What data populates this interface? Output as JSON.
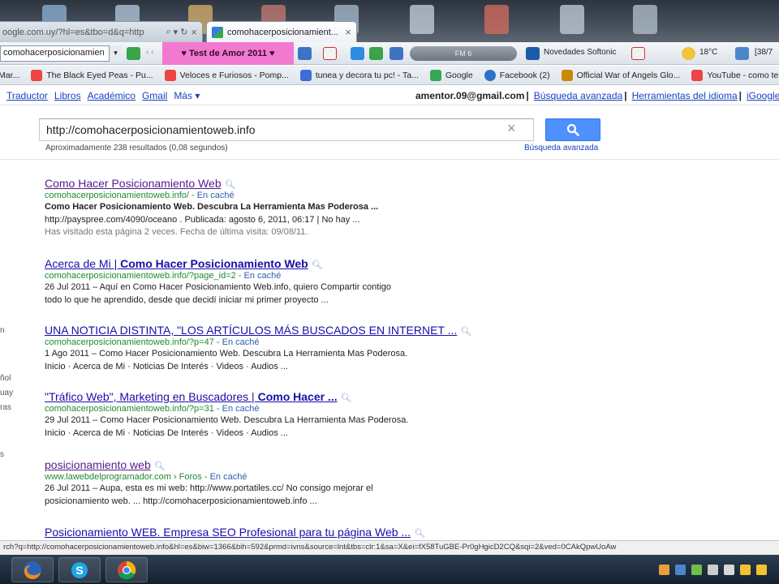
{
  "colors": {
    "accent": "#4d90fe",
    "link": "#1a0dab",
    "visited": "#551a8b",
    "url_green": "#1e8a2e",
    "pink_toolbar": "#f279d0"
  },
  "tabs": [
    {
      "title": "oogle.com.uy/?hl=es&tbo=d&q=http",
      "active": false
    },
    {
      "title": "comohacerposicionamient...",
      "active": true
    }
  ],
  "toolbar": {
    "search_value": "comohacerposicionamien",
    "pink_label": "♥ Test de Amor 2011 ♥",
    "radio_label": "FM 6",
    "novedades": "Novedades Softonic",
    "weather": "18°C",
    "extra": "[38/7"
  },
  "bookmarks": [
    {
      "label": "Mar...",
      "icon": "heart-icon",
      "color": "#d44"
    },
    {
      "label": "The Black Eyed Peas - Pu...",
      "icon": "heart-icon",
      "color": "#e44"
    },
    {
      "label": "Veloces e Furiosos - Pomp...",
      "icon": "heart-icon",
      "color": "#e44"
    },
    {
      "label": "tunea y decora tu pc! - Ta...",
      "icon": "page-icon",
      "color": "#3b6fd8"
    },
    {
      "label": "Google",
      "icon": "google-icon",
      "color": "#35a853"
    },
    {
      "label": "Facebook (2)",
      "icon": "globe-icon",
      "color": "#2a73c9"
    },
    {
      "label": "Official War of Angels Glo...",
      "icon": "game-icon",
      "color": "#c88b00"
    },
    {
      "label": "YouTube - como ter...",
      "icon": "heart-icon",
      "color": "#e44"
    }
  ],
  "gbar": {
    "links": [
      "Traductor",
      "Libros",
      "Académico",
      "Gmail",
      "Más ▾"
    ],
    "email": "amentor.09@gmail.com",
    "advanced": "Búsqueda avanzada",
    "language_tools": "Herramientas del idioma",
    "igoogle": "iGoogle"
  },
  "search": {
    "query": "http://comohacerposicionamientoweb.info",
    "stats": "Aproximadamente 238 resultados (0,08 segundos)",
    "advanced": "Búsqueda avanzada"
  },
  "left_fragments": [
    "n",
    "ñol",
    "uay",
    "ras",
    "s"
  ],
  "results": [
    {
      "title": "Como Hacer Posicionamiento Web",
      "visited": true,
      "url": "comohacerposicionamientoweb.info/",
      "cache": "En caché",
      "snippets": [
        "Como Hacer Posicionamiento Web. Descubra La Herramienta Mas Poderosa ...",
        "http://payspree.com/4090/oceano . Publicada: agosto 6, 2011, 06:17 | No hay ..."
      ],
      "visited_note": "Has visitado esta página 2 veces. Fecha de última visita: 09/08/11."
    },
    {
      "title_plain": "Acerca de Mi | ",
      "title_bold": "Como Hacer Posicionamiento Web",
      "visited": false,
      "url": "comohacerposicionamientoweb.info/?page_id=2",
      "cache": "En caché",
      "snippets": [
        "26 Jul 2011 – Aquí en Como Hacer Posicionamiento Web.info, quiero Compartir contigo",
        "todo lo que he aprendido, desde que decidí iniciar mi primer proyecto ..."
      ]
    },
    {
      "title": "UNA NOTICIA DISTINTA, \"LOS ARTÍCULOS MÁS BUSCADOS EN INTERNET ...",
      "visited": false,
      "url": "comohacerposicionamientoweb.info/?p=47",
      "cache": "En caché",
      "snippets": [
        "1 Ago 2011 – Como Hacer Posicionamiento Web. Descubra La Herramienta Mas Poderosa.",
        "Inicio · Acerca de Mi · Noticias De Interés · Videos · Audios ..."
      ]
    },
    {
      "title_plain": "\"Tráfico Web\", Marketing en Buscadores | ",
      "title_bold": "Como Hacer ...",
      "visited": false,
      "url": "comohacerposicionamientoweb.info/?p=31",
      "cache": "En caché",
      "snippets": [
        "29 Jul 2011 – Como Hacer Posicionamiento Web. Descubra La Herramienta Mas Poderosa.",
        "Inicio · Acerca de Mi · Noticias De Interés · Videos · Audios ..."
      ]
    },
    {
      "title": "posicionamiento web",
      "visited": true,
      "url": "www.lawebdelprogramador.com › Foros",
      "cache": "En caché",
      "snippets": [
        "26 Jul 2011 – Aupa, esta es mi web: http://www.portatiles.cc/ No consigo mejorar el",
        "posicionamiento web. ... http://comohacerposicionamientoweb.info ..."
      ]
    },
    {
      "title": "Posicionamiento WEB. Empresa SEO Profesional para tu página Web ...",
      "visited": false
    }
  ],
  "status": "rch?q=http://comohacerposicionamientoweb.info&hl=es&biw=1366&bih=592&prmd=ivns&source=lnt&tbs=clr:1&sa=X&ei=fX58TuGBE-Pr0gHgicD2CQ&sqi=2&ved=0CAkQpwUoAw"
}
